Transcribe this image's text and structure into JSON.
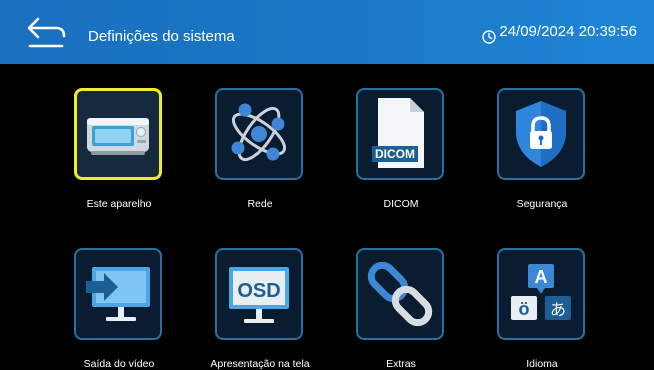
{
  "header": {
    "title": "Definições do sistema",
    "datetime": "24/09/2024 20:39:56"
  },
  "tiles": [
    {
      "label": "Este aparelho",
      "icon": "ultrasound-device-icon",
      "selected": true
    },
    {
      "label": "Rede",
      "icon": "network-atom-icon"
    },
    {
      "label": "DICOM",
      "icon": "dicom-file-icon",
      "badge": "DICOM"
    },
    {
      "label": "Segurança",
      "icon": "security-shield-lock-icon"
    },
    {
      "label": "Saída do vídeo",
      "icon": "video-output-monitor-icon"
    },
    {
      "label": "Apresentação na tela",
      "icon": "osd-monitor-icon",
      "badge": "OSD"
    },
    {
      "label": "Extras",
      "icon": "chain-link-icon"
    },
    {
      "label": "Idioma",
      "icon": "language-icon",
      "glyphs": [
        "A",
        "ö",
        "あ"
      ]
    }
  ],
  "colors": {
    "header": "#1b78c6",
    "tile_border": "#27709f",
    "selected_border": "#f1ea2e",
    "background": "#000000"
  }
}
